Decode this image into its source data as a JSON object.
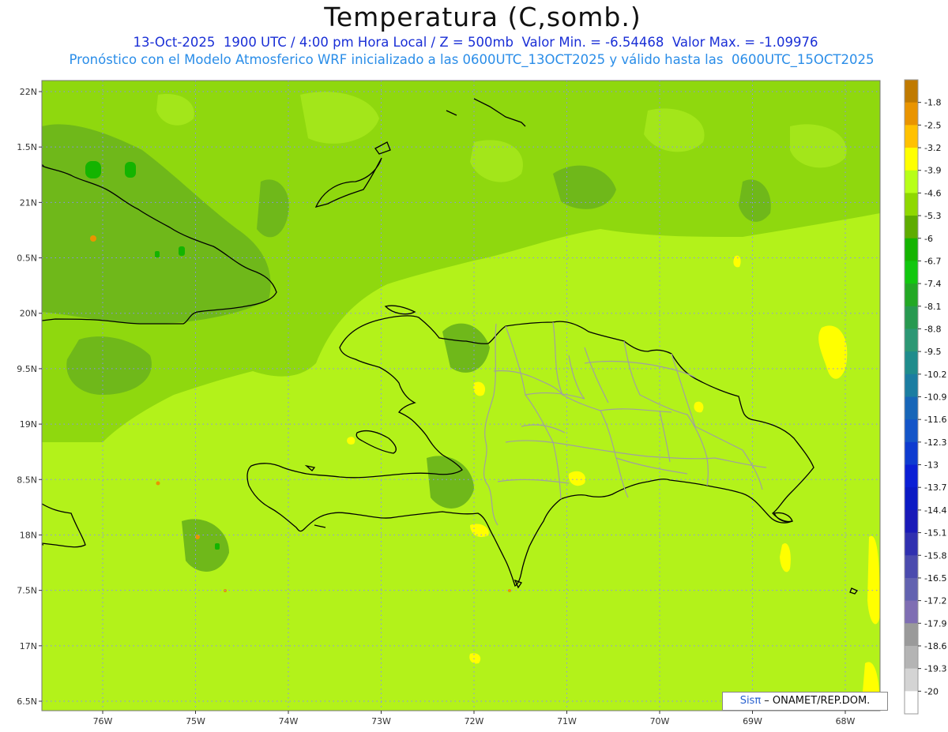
{
  "title": "Temperatura (C,somb.)",
  "subtitle_line1": "13-Oct-2025  1900 UTC / 4:00 pm Hora Local / Z = 500mb  Valor Min. = -6.54468  Valor Max. = -1.09976",
  "subtitle_line2": "Pronóstico con el Modelo Atmosferico WRF inicializado a las 0600UTC_13OCT2025 y válido hasta las  0600UTC_15OCT2025",
  "lat_labels": [
    "22N",
    "1.5N",
    "21N",
    "0.5N",
    "20N",
    "9.5N",
    "19N",
    "8.5N",
    "18N",
    "7.5N",
    "17N",
    "6.5N"
  ],
  "lon_labels": [
    "76W",
    "75W",
    "74W",
    "73W",
    "72W",
    "71W",
    "70W",
    "69W",
    "68W"
  ],
  "colorbar": {
    "labels": [
      "-1.8",
      "-2.5",
      "-3.2",
      "-3.9",
      "-4.6",
      "-5.3",
      "-6",
      "-6.7",
      "-7.4",
      "-8.1",
      "-8.8",
      "-9.5",
      "-10.2",
      "-10.9",
      "-11.6",
      "-12.3",
      "-13",
      "-13.7",
      "-14.4",
      "-15.1",
      "-15.8",
      "-16.5",
      "-17.2",
      "-17.9",
      "-18.6",
      "-19.3",
      "-20"
    ],
    "colors": [
      "#c07a00",
      "#e99400",
      "#ffc100",
      "#ffff00",
      "#b8ff18",
      "#8fd800",
      "#5eac00",
      "#14b400",
      "#11c70e",
      "#23a824",
      "#289950",
      "#2c9774",
      "#1f8c8c",
      "#1b7da1",
      "#1766b8",
      "#1455c8",
      "#0e3bd0",
      "#0b1fd5",
      "#0b1ac4",
      "#1a1ab8",
      "#3030b0",
      "#4b4bae",
      "#6262b0",
      "#7f6eb3",
      "#9a9a9a",
      "#b4b4b4",
      "#d4d4d4",
      "#ffffff"
    ]
  },
  "colors": {
    "base_field": "#b3f21a",
    "north_field": "#8fd80e",
    "dark_patch": "#6fb81a",
    "warm_patch": "#ffff00",
    "grid_dots": "#8a8aff",
    "coastline": "#000000",
    "borders": "#a0a0a0"
  },
  "credit": {
    "brand": "Sisπ",
    "text": " – ONAMET/REP.DOM."
  }
}
